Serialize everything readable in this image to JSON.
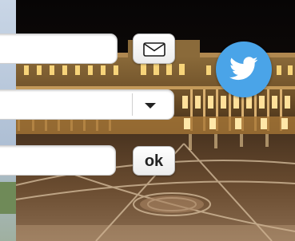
{
  "form": {
    "email_value": "",
    "select_value": "",
    "code_value": "",
    "ok_label": "ok"
  },
  "icons": {
    "mail": "envelope-icon",
    "dropdown": "chevron-down-icon",
    "social": "twitter-bird-icon"
  },
  "colors": {
    "twitter_blue": "#4aa4e8",
    "field_bg": "#ffffff",
    "button_text": "#222222"
  }
}
